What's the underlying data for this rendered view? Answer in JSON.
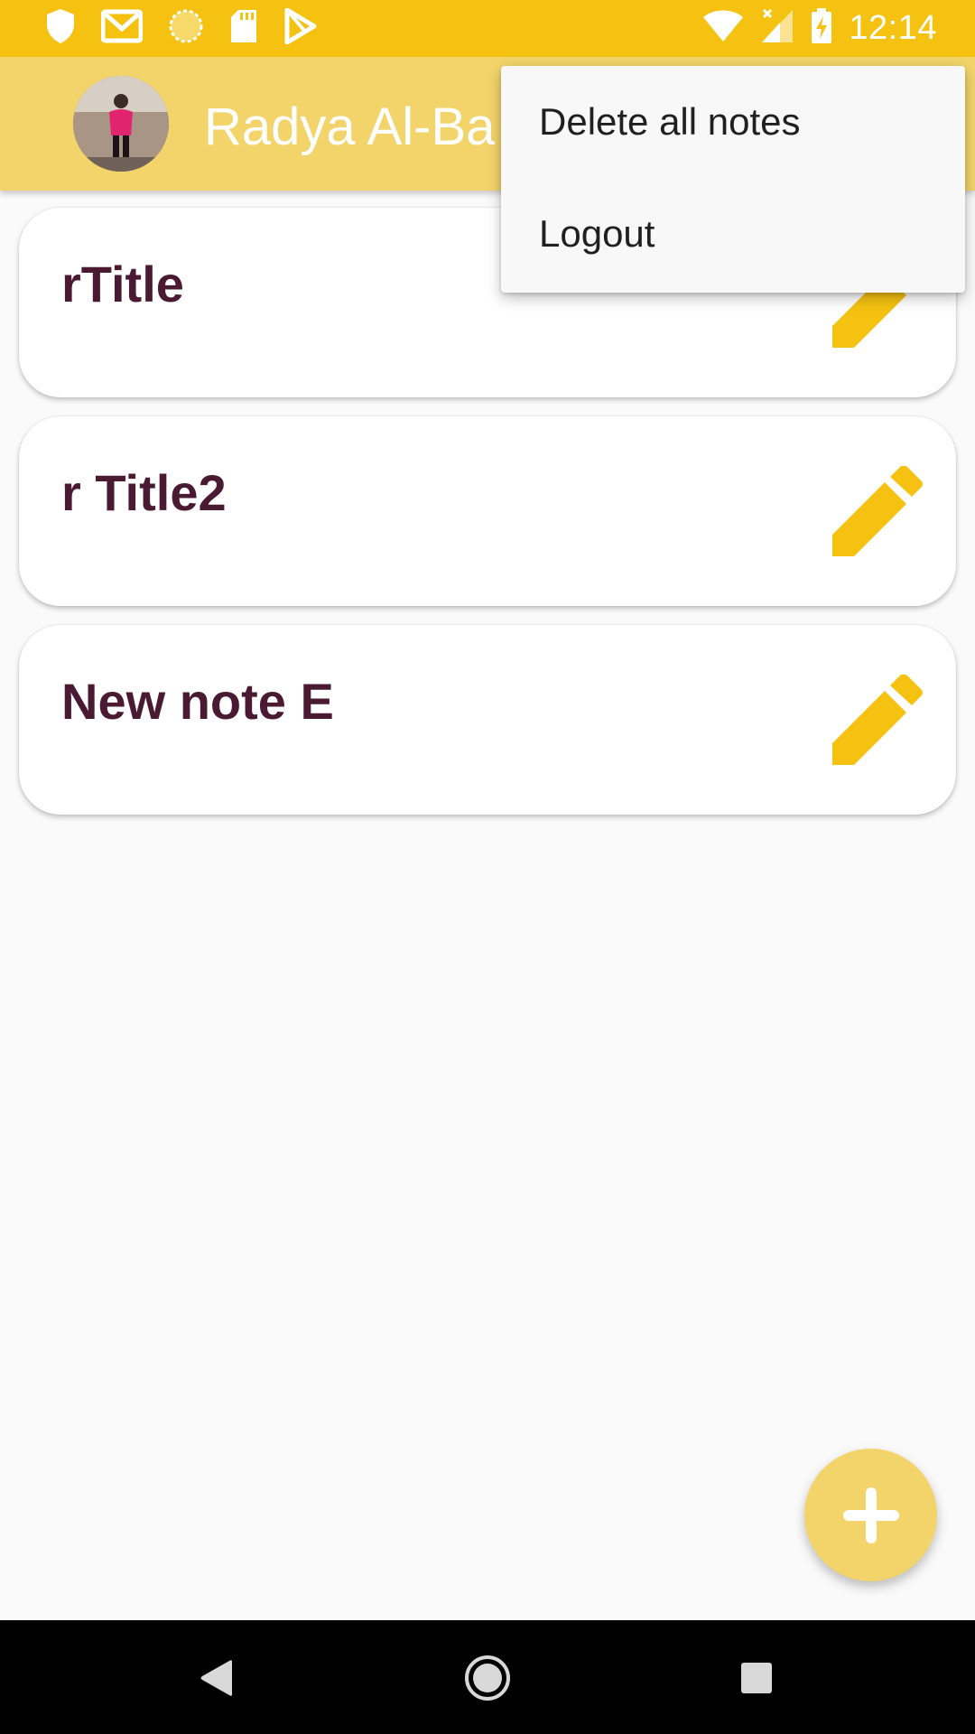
{
  "status_bar": {
    "time": "12:14",
    "left_icons": [
      "shield-icon",
      "gmail-icon",
      "sun-icon",
      "sd-card-icon",
      "play-store-icon"
    ],
    "right_icons": [
      "wifi-icon",
      "signal-icon",
      "battery-charging-icon"
    ]
  },
  "app_bar": {
    "title": "Radya Al-Ba",
    "avatar": "avatar"
  },
  "notes": [
    {
      "title": "rTitle"
    },
    {
      "title": "r Title2"
    },
    {
      "title": "New note E"
    }
  ],
  "overflow_menu": {
    "items": [
      "Delete all notes",
      "Logout"
    ]
  },
  "fab": {
    "icon": "plus-icon"
  },
  "nav_bar": {
    "icons": [
      "back-icon",
      "home-icon",
      "recents-icon"
    ]
  },
  "colors": {
    "status_bar": "#f5c211",
    "app_bar": "#f2d46a",
    "accent": "#f5c211",
    "note_title": "#4a1a33"
  }
}
